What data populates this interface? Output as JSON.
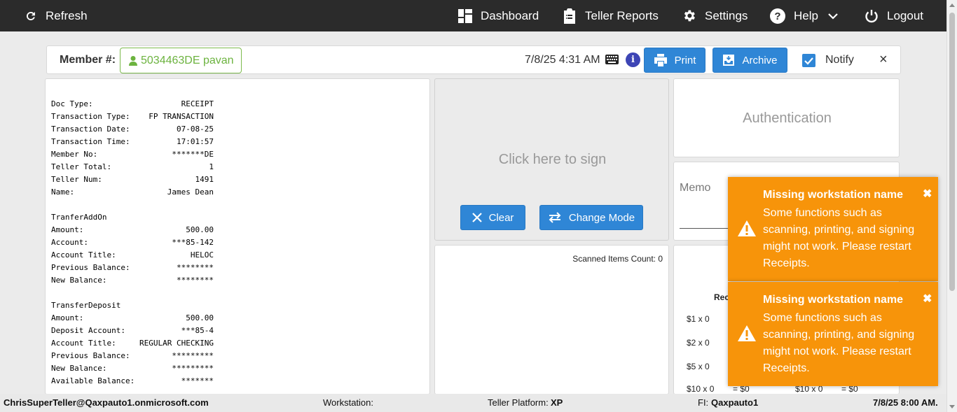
{
  "nav": {
    "refresh": "Refresh",
    "dashboard": "Dashboard",
    "teller_reports": "Teller Reports",
    "settings": "Settings",
    "help": "Help",
    "logout": "Logout"
  },
  "member_bar": {
    "label": "Member #:",
    "member": "5034463DE pavan",
    "datetime": "7/8/25 4:31 AM",
    "print": "Print",
    "archive": "Archive",
    "notify": "Notify",
    "notify_checked": true,
    "close": "×"
  },
  "receipt": {
    "header": [
      {
        "k": "Doc Type:",
        "v": "RECEIPT"
      },
      {
        "k": "Transaction Type:",
        "v": "FP TRANSACTION"
      },
      {
        "k": "Transaction Date:",
        "v": "07-08-25"
      },
      {
        "k": "Transaction Time:",
        "v": "17:01:57"
      },
      {
        "k": "Member No:",
        "v": "*******DE"
      },
      {
        "k": "Teller Total:",
        "v": "1"
      },
      {
        "k": "Teller Num:",
        "v": "1491"
      },
      {
        "k": "Name:",
        "v": "James Dean"
      }
    ],
    "addon_title": "TranferAddOn",
    "addon": [
      {
        "k": "Amount:",
        "v": "500.00"
      },
      {
        "k": "Account:",
        "v": "***85-142"
      },
      {
        "k": "Account Title:",
        "v": "HELOC"
      },
      {
        "k": "Previous Balance:",
        "v": "********"
      },
      {
        "k": "New Balance:",
        "v": "********"
      }
    ],
    "deposit_title": "TransferDeposit",
    "deposit": [
      {
        "k": "Amount:",
        "v": "500.00"
      },
      {
        "k": "Deposit Account:",
        "v": "***85-4"
      },
      {
        "k": "Account Title:",
        "v": "REGULAR CHECKING"
      },
      {
        "k": "Previous Balance:",
        "v": "*********"
      },
      {
        "k": "New Balance:",
        "v": "*********"
      },
      {
        "k": "Available Balance:",
        "v": "*******"
      }
    ]
  },
  "signature": {
    "prompt": "Click here to sign",
    "clear": "Clear",
    "change_mode": "Change Mode"
  },
  "scanned": {
    "label": "Scanned Items Count: 0"
  },
  "auth": {
    "label": "Authentication"
  },
  "memo": {
    "label": "Memo"
  },
  "cash": {
    "title": "Rec",
    "denoms": [
      "$1 x 0",
      "$2 x 0",
      "$5 x 0"
    ],
    "bottom_row": [
      "$10 x 0",
      "= $0",
      "$10 x 0",
      "= $0"
    ]
  },
  "toasts": [
    {
      "title": "Missing workstation name",
      "message": "Some functions such as scanning, printing, and signing might not work. Please restart Receipts.",
      "close": "✖"
    },
    {
      "title": "Missing workstation name",
      "message": "Some functions such as scanning, printing, and signing might not work. Please restart Receipts.",
      "close": "✖"
    }
  ],
  "footer": {
    "user": "ChrisSuperTeller@Qaxpauto1.onmicrosoft.com",
    "workstation_label": "Workstation:",
    "platform_label": "Teller Platform:",
    "platform_value": "XP",
    "fi_label": "FI:",
    "fi_value": "Qaxpauto1",
    "datetime": "7/8/25 8:00 AM."
  },
  "colors": {
    "nav_bg": "#2b2b2b",
    "primary_blue": "#2f86d6",
    "member_green": "#6cb33f",
    "toast_orange": "#f7940a",
    "info_blue": "#3d45b5"
  },
  "icons": {
    "refresh": "refresh-icon",
    "dashboard": "dashboard-icon",
    "reports": "clipboard-icon",
    "settings": "gear-icon",
    "help": "question-circle-icon",
    "logout": "power-icon",
    "member": "user-icon",
    "keyboard": "keyboard-icon",
    "info": "info-icon",
    "print": "printer-icon",
    "archive": "archive-icon",
    "warning": "warning-icon"
  }
}
